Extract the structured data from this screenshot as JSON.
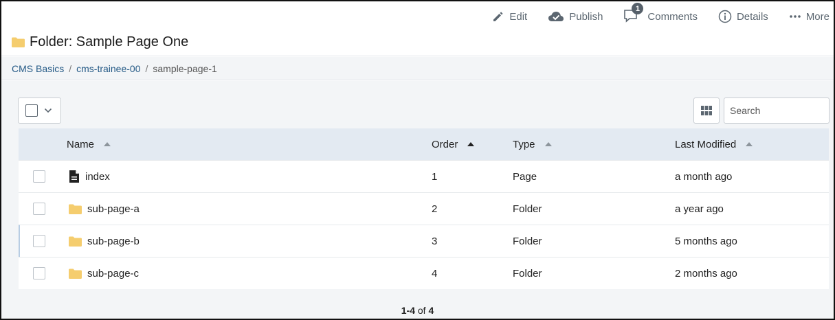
{
  "toolbar": {
    "edit": "Edit",
    "publish": "Publish",
    "comments": "Comments",
    "comments_count": "1",
    "details": "Details",
    "more": "More"
  },
  "header": {
    "title": "Folder: Sample Page One"
  },
  "breadcrumb": {
    "items": [
      {
        "label": "CMS Basics"
      },
      {
        "label": "cms-trainee-00"
      },
      {
        "label": "sample-page-1"
      }
    ],
    "separator": "/"
  },
  "search": {
    "placeholder": "Search"
  },
  "table": {
    "columns": [
      {
        "label": "Name"
      },
      {
        "label": "Order"
      },
      {
        "label": "Type"
      },
      {
        "label": "Last Modified"
      }
    ],
    "rows": [
      {
        "name": "index",
        "icon": "document-icon",
        "order": "1",
        "type": "Page",
        "modified": "a month ago"
      },
      {
        "name": "sub-page-a",
        "icon": "folder-icon",
        "order": "2",
        "type": "Folder",
        "modified": "a year ago"
      },
      {
        "name": "sub-page-b",
        "icon": "folder-icon",
        "order": "3",
        "type": "Folder",
        "modified": "5 months ago"
      },
      {
        "name": "sub-page-c",
        "icon": "folder-icon",
        "order": "4",
        "type": "Folder",
        "modified": "2 months ago"
      }
    ]
  },
  "pager": {
    "range": "1-4",
    "of": "of",
    "total": "4"
  },
  "colors": {
    "link": "#255a86",
    "folder": "#f5cd6e",
    "header_row": "#e3eaf2",
    "panel": "#f3f5f7"
  }
}
